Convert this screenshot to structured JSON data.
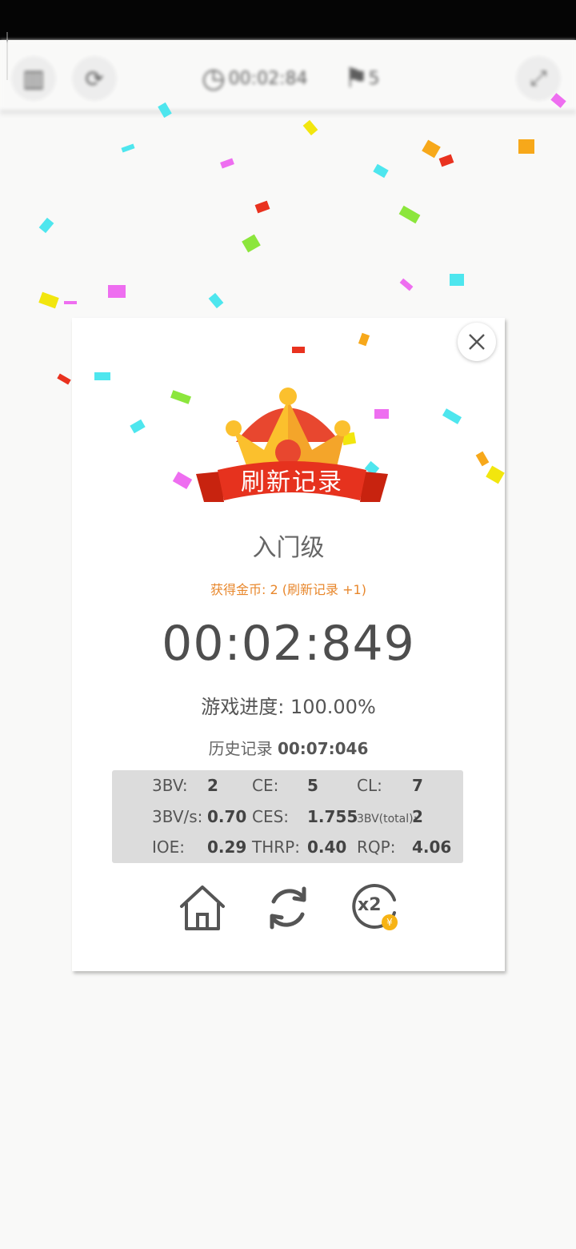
{
  "toolbar": {
    "timer": "00:02:84",
    "flags": "5",
    "items": [
      {
        "icon": "menu-icon"
      },
      {
        "icon": "restart-icon"
      },
      {
        "icon": "clock-icon"
      },
      {
        "icon": "flag-icon"
      },
      {
        "icon": "expand-icon"
      }
    ]
  },
  "dialog": {
    "banner": "刷新记录",
    "level": "入门级",
    "coins": "获得金币: 2 (刷新记录 +1)",
    "time": "00:02:849",
    "progress_label": "游戏进度:",
    "progress_value": "100.00%",
    "history_label": "历史记录",
    "history_value": "00:07:046",
    "stats": [
      {
        "label": "3BV:",
        "value": "2"
      },
      {
        "label": "CE:",
        "value": "5"
      },
      {
        "label": "CL:",
        "value": "7"
      },
      {
        "label": "3BV/s:",
        "value": "0.70"
      },
      {
        "label": "CES:",
        "value": "1.755"
      },
      {
        "label": "3BV(total):",
        "value": "2"
      },
      {
        "label": "IOE:",
        "value": "0.29"
      },
      {
        "label": "THRP:",
        "value": "0.40"
      },
      {
        "label": "RQP:",
        "value": "4.06"
      }
    ],
    "actions": {
      "home": "home-icon",
      "retry": "retry-icon",
      "double": "x2",
      "coin_symbol": "¥"
    }
  },
  "colors": {
    "accent_orange": "#e8872c",
    "ribbon_red": "#e6321e",
    "crown_yellow": "#fbc02d",
    "text_dark": "#4e4e4e"
  }
}
